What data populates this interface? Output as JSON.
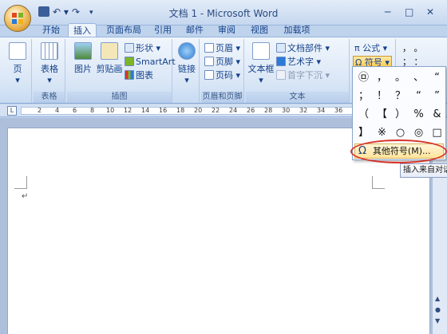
{
  "window": {
    "title": "文档 1 - Microsoft Word",
    "min": "─",
    "max": "□",
    "close": "✕"
  },
  "qat": {
    "undo": "↶ ▾",
    "redo": "↷",
    "customize": "▾"
  },
  "tabs": [
    "开始",
    "插入",
    "页面布局",
    "引用",
    "邮件",
    "审阅",
    "视图",
    "加载项"
  ],
  "active_tab": "插入",
  "ribbon": {
    "pages": {
      "page_label": "页",
      "arrow": "▾"
    },
    "tables": {
      "table_label": "表格",
      "arrow": "▾",
      "group_label": "表格"
    },
    "illustrations": {
      "picture": "图片",
      "clipart": "剪贴画",
      "shapes": "形状 ▾",
      "smartart": "SmartArt",
      "chart": "图表",
      "group_label": "插图"
    },
    "links": {
      "link_label": "链接",
      "arrow": "▾"
    },
    "header_footer": {
      "header": "页眉 ▾",
      "footer": "页脚 ▾",
      "page_number": "页码 ▾",
      "group_label": "页眉和页脚"
    },
    "text": {
      "textbox": "文本框",
      "textbox_arrow": "▾",
      "quickparts": "文档部件 ▾",
      "wordart": "艺术字 ▾",
      "dropcap": "首字下沉 ▾",
      "group_label": "文本"
    },
    "symbols": {
      "equation": "π 公式 ▾",
      "symbol": "Ω 符号 ▾"
    },
    "special": {
      "row1": "，  。",
      "row2": "；  ："
    }
  },
  "ruler": {
    "numbers": [
      "2",
      "4",
      "6",
      "8",
      "10",
      "12",
      "14",
      "16",
      "18",
      "20",
      "22",
      "24",
      "26",
      "28",
      "30",
      "32",
      "34",
      "36",
      "38",
      "40"
    ]
  },
  "symbol_dropdown": {
    "symbols": [
      "㉤",
      "，",
      "。",
      "、",
      "“",
      "；",
      "！",
      "？",
      "“",
      "”",
      "（",
      "【",
      "）",
      "%",
      "&",
      "】",
      "※",
      "○",
      "◎",
      "□"
    ],
    "more_symbols": "其他符号(M)..."
  },
  "tooltip": {
    "text": "插入来自对话"
  },
  "document": {
    "para_mark": "↵"
  },
  "colors": {
    "ribbon_blue": "#15428b",
    "highlight_red": "#d9342b"
  }
}
